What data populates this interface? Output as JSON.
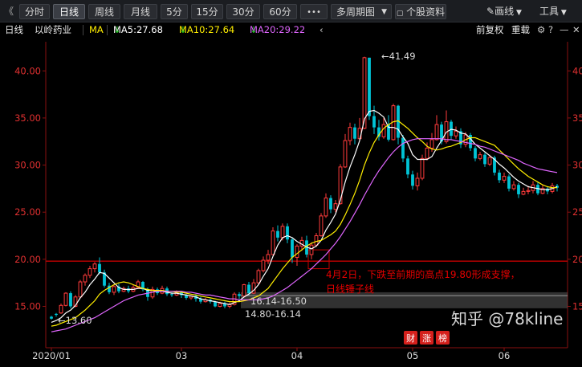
{
  "toolbar": {
    "back_icon": "chevron-left-icon",
    "tabs": [
      "分时",
      "日线",
      "周线",
      "月线",
      "5分",
      "15分",
      "30分",
      "60分"
    ],
    "active_tab": "日线",
    "more": "•••",
    "multi_period": "多周期图",
    "stock_info": "个股资料",
    "draw_line": "画线",
    "tools": "工具",
    "dropdown_icon": "triangle-down-icon",
    "pen_icon": "pen-icon",
    "window_icons": [
      "maximize-icon",
      "close-icon"
    ]
  },
  "infobar": {
    "period": "日线",
    "name": "以岭药业",
    "ma": "MA",
    "ma5": "MA5:27.68",
    "ma10": "MA10:27.64",
    "ma20": "MA20:29.22",
    "collapse_icon": "chevron-left-icon",
    "adjust": "前复权",
    "overlay": "重载",
    "icons": [
      "settings-icon",
      "help-icon",
      "minimize-icon",
      "close-icon"
    ]
  },
  "colors": {
    "up": "#ff3b3b",
    "down": "#00c4d6",
    "ma5": "#ffffff",
    "ma10": "#ffee00",
    "ma20": "#e066ff",
    "support_line": "#c40000",
    "axis_text": "#e03030",
    "annotation": "#e60000"
  },
  "annotations": {
    "high_label": "41.49",
    "low_label": "13.60",
    "box_label1": "16.14-16.50",
    "box_label2": "14.80-16.14",
    "note_line1": "4月2日，下跌至前期的高点19.80形成支撑，",
    "note_line2": "日线锤子线"
  },
  "watermark": {
    "badge1": "财",
    "badge2": "涨",
    "badge3": "榜",
    "text": "知乎 @78kline"
  },
  "chart_data": {
    "type": "candlestick",
    "title": "以岭药业 日线",
    "xlabel": "",
    "ylabel": "",
    "ylim": [
      12,
      43
    ],
    "y_ticks": [
      15,
      20,
      25,
      30,
      35,
      40
    ],
    "y_tick_labels_left": [
      "15.00",
      "20.00",
      "25.00",
      "30.00",
      "35.00",
      "40.00"
    ],
    "y_tick_labels_right": [
      "15",
      "20",
      "25",
      "30",
      "35",
      "40"
    ],
    "x_tick_labels": [
      {
        "label": "2020/01",
        "index": 0
      },
      {
        "label": "03",
        "index": 27
      },
      {
        "label": "04",
        "index": 51
      },
      {
        "label": "05",
        "index": 75
      },
      {
        "label": "06",
        "index": 94
      }
    ],
    "support_level": 19.8,
    "support_box": [
      14.8,
      16.5
    ],
    "grid": false,
    "candles": [
      [
        13.9,
        13.7,
        14.0,
        13.6
      ],
      [
        14.2,
        14.1,
        14.3,
        13.9
      ],
      [
        14.3,
        15.1,
        15.3,
        14.2
      ],
      [
        15.1,
        16.4,
        16.5,
        15.0
      ],
      [
        16.4,
        15.0,
        16.6,
        14.8
      ],
      [
        15.0,
        16.0,
        16.2,
        14.9
      ],
      [
        16.0,
        17.6,
        17.8,
        15.9
      ],
      [
        17.6,
        18.3,
        18.5,
        17.2
      ],
      [
        18.3,
        19.0,
        19.3,
        18.0
      ],
      [
        19.0,
        19.5,
        19.7,
        18.6
      ],
      [
        19.5,
        18.6,
        20.2,
        18.4
      ],
      [
        18.6,
        17.2,
        18.9,
        17.0
      ],
      [
        17.2,
        16.5,
        17.5,
        16.3
      ],
      [
        16.5,
        17.1,
        17.3,
        16.2
      ],
      [
        17.1,
        16.6,
        17.4,
        16.4
      ],
      [
        16.6,
        16.9,
        17.1,
        16.5
      ],
      [
        16.9,
        16.6,
        17.2,
        16.4
      ],
      [
        16.6,
        17.0,
        17.3,
        16.5
      ],
      [
        17.0,
        17.6,
        17.8,
        16.9
      ],
      [
        17.6,
        16.8,
        17.7,
        16.6
      ],
      [
        16.8,
        16.0,
        17.0,
        15.6
      ],
      [
        16.0,
        16.8,
        17.1,
        15.8
      ],
      [
        16.8,
        16.4,
        17.0,
        16.2
      ],
      [
        16.4,
        16.9,
        17.2,
        16.3
      ],
      [
        16.9,
        16.3,
        17.1,
        16.1
      ],
      [
        16.3,
        16.2,
        16.5,
        16.0
      ],
      [
        16.2,
        16.5,
        16.7,
        16.1
      ],
      [
        16.5,
        16.2,
        16.6,
        15.9
      ],
      [
        16.2,
        15.9,
        16.3,
        15.7
      ],
      [
        15.9,
        16.1,
        16.2,
        15.7
      ],
      [
        16.1,
        15.8,
        16.3,
        15.5
      ],
      [
        15.8,
        15.5,
        16.0,
        15.3
      ],
      [
        15.5,
        15.7,
        15.9,
        15.4
      ],
      [
        15.7,
        15.5,
        15.8,
        15.3
      ],
      [
        15.5,
        15.0,
        15.6,
        14.9
      ],
      [
        15.0,
        15.3,
        15.5,
        14.9
      ],
      [
        15.3,
        15.0,
        15.5,
        14.8
      ],
      [
        15.0,
        15.2,
        15.4,
        14.8
      ],
      [
        15.2,
        16.3,
        16.5,
        15.1
      ],
      [
        16.3,
        16.1,
        16.5,
        15.8
      ],
      [
        16.1,
        17.3,
        17.4,
        16.0
      ],
      [
        17.3,
        16.4,
        17.6,
        16.2
      ],
      [
        16.4,
        17.5,
        17.9,
        16.3
      ],
      [
        17.5,
        18.8,
        19.0,
        17.3
      ],
      [
        18.8,
        19.9,
        20.3,
        18.6
      ],
      [
        19.9,
        20.5,
        21.0,
        19.5
      ],
      [
        20.5,
        23.0,
        23.4,
        20.4
      ],
      [
        23.0,
        22.3,
        23.6,
        21.9
      ],
      [
        22.3,
        23.5,
        23.8,
        22.0
      ],
      [
        23.5,
        22.1,
        23.8,
        21.7
      ],
      [
        22.1,
        20.2,
        22.3,
        19.6
      ],
      [
        20.2,
        21.4,
        21.6,
        19.3
      ],
      [
        21.4,
        22.0,
        22.4,
        20.9
      ],
      [
        22.0,
        20.5,
        22.5,
        20.2
      ],
      [
        20.5,
        21.5,
        21.8,
        20.0
      ],
      [
        21.5,
        22.5,
        22.8,
        21.3
      ],
      [
        22.5,
        24.6,
        24.9,
        22.4
      ],
      [
        24.6,
        26.5,
        27.0,
        24.4
      ],
      [
        26.5,
        25.3,
        26.8,
        24.9
      ],
      [
        25.3,
        25.9,
        26.3,
        25.0
      ],
      [
        25.9,
        29.8,
        30.1,
        25.8
      ],
      [
        29.8,
        32.6,
        33.3,
        29.7
      ],
      [
        32.6,
        34.0,
        34.5,
        32.1
      ],
      [
        34.0,
        32.8,
        34.4,
        32.2
      ],
      [
        32.8,
        33.9,
        35.0,
        32.6
      ],
      [
        33.9,
        41.4,
        41.5,
        33.8
      ],
      [
        41.4,
        35.2,
        41.4,
        34.8
      ],
      [
        35.2,
        34.0,
        36.3,
        33.3
      ],
      [
        34.0,
        33.0,
        34.8,
        32.6
      ],
      [
        33.0,
        34.3,
        35.0,
        32.8
      ],
      [
        34.3,
        32.7,
        35.3,
        32.5
      ],
      [
        32.7,
        36.3,
        36.5,
        32.6
      ],
      [
        36.3,
        32.9,
        36.4,
        32.2
      ],
      [
        32.9,
        30.7,
        33.2,
        30.3
      ],
      [
        30.7,
        29.0,
        31.0,
        28.6
      ],
      [
        29.0,
        27.8,
        29.4,
        27.4
      ],
      [
        27.8,
        28.6,
        29.2,
        27.3
      ],
      [
        28.6,
        30.7,
        31.1,
        28.4
      ],
      [
        30.7,
        31.8,
        32.4,
        30.5
      ],
      [
        31.8,
        32.7,
        33.4,
        31.4
      ],
      [
        32.7,
        34.3,
        35.3,
        32.6
      ],
      [
        34.3,
        32.5,
        34.6,
        32.2
      ],
      [
        32.5,
        34.6,
        35.8,
        32.3
      ],
      [
        34.6,
        33.1,
        34.8,
        32.7
      ],
      [
        33.1,
        33.6,
        34.1,
        32.8
      ],
      [
        33.6,
        32.2,
        33.9,
        31.8
      ],
      [
        32.2,
        33.2,
        33.5,
        31.9
      ],
      [
        33.2,
        31.8,
        33.4,
        31.5
      ],
      [
        31.8,
        30.7,
        32.0,
        30.4
      ],
      [
        30.7,
        31.1,
        31.4,
        30.5
      ],
      [
        31.1,
        30.1,
        31.3,
        29.8
      ],
      [
        30.1,
        30.8,
        31.1,
        29.9
      ],
      [
        30.8,
        29.2,
        31.0,
        28.9
      ],
      [
        29.2,
        28.4,
        29.5,
        28.1
      ],
      [
        28.4,
        28.8,
        29.2,
        28.1
      ],
      [
        28.8,
        27.5,
        29.0,
        27.2
      ],
      [
        27.5,
        27.9,
        28.3,
        27.3
      ],
      [
        27.9,
        26.9,
        28.1,
        26.5
      ],
      [
        26.9,
        27.2,
        27.6,
        26.8
      ],
      [
        27.2,
        27.3,
        27.8,
        26.9
      ],
      [
        27.3,
        27.9,
        28.3,
        27.0
      ],
      [
        27.9,
        27.0,
        28.2,
        26.8
      ],
      [
        27.0,
        27.5,
        27.9,
        26.9
      ],
      [
        27.5,
        27.2,
        27.7,
        26.9
      ],
      [
        27.2,
        27.8,
        28.1,
        27.0
      ],
      [
        27.8,
        27.6,
        28.0,
        27.2
      ]
    ],
    "series": [
      {
        "name": "MA5",
        "values": [
          13.3,
          13.5,
          13.8,
          14.3,
          14.6,
          15.1,
          15.9,
          16.5,
          17.3,
          17.9,
          18.6,
          18.5,
          18.0,
          17.5,
          17.0,
          16.8,
          16.8,
          16.8,
          16.9,
          16.9,
          16.7,
          16.7,
          16.6,
          16.6,
          16.5,
          16.4,
          16.4,
          16.3,
          16.2,
          16.1,
          16.0,
          15.8,
          15.7,
          15.6,
          15.5,
          15.4,
          15.3,
          15.2,
          15.4,
          15.6,
          16.0,
          16.3,
          16.7,
          17.3,
          18.2,
          19.0,
          20.3,
          21.5,
          22.3,
          22.5,
          22.3,
          21.9,
          21.6,
          21.3,
          21.1,
          21.4,
          22.0,
          23.1,
          23.9,
          24.8,
          26.3,
          28.2,
          29.8,
          31.1,
          32.6,
          34.9,
          35.7,
          35.8,
          35.5,
          35.1,
          34.0,
          34.0,
          33.8,
          33.0,
          32.3,
          31.1,
          30.6,
          30.6,
          30.6,
          30.9,
          31.8,
          32.6,
          33.5,
          33.8,
          33.7,
          33.4,
          33.3,
          32.8,
          32.2,
          31.8,
          31.4,
          31.0,
          30.6,
          30.1,
          29.7,
          29.2,
          28.7,
          28.3,
          28.0,
          27.7,
          27.6,
          27.5,
          27.4,
          27.4,
          27.5,
          27.7
        ]
      },
      {
        "name": "MA10",
        "values": [
          12.9,
          13.0,
          13.2,
          13.4,
          13.6,
          13.8,
          14.2,
          14.6,
          15.1,
          15.6,
          16.3,
          16.7,
          17.0,
          17.3,
          17.5,
          17.6,
          17.5,
          17.3,
          17.1,
          16.9,
          16.8,
          16.7,
          16.7,
          16.7,
          16.6,
          16.6,
          16.5,
          16.5,
          16.4,
          16.3,
          16.2,
          16.1,
          16.0,
          15.9,
          15.8,
          15.7,
          15.6,
          15.5,
          15.5,
          15.5,
          15.6,
          15.7,
          15.9,
          16.1,
          16.5,
          16.9,
          17.6,
          18.3,
          19.0,
          19.6,
          20.2,
          20.6,
          21.0,
          21.4,
          21.7,
          21.9,
          22.0,
          22.3,
          22.6,
          23.0,
          23.7,
          24.7,
          25.8,
          27.0,
          28.4,
          30.0,
          31.3,
          32.4,
          33.2,
          33.9,
          34.3,
          34.6,
          34.7,
          34.3,
          33.9,
          33.4,
          32.9,
          32.5,
          32.0,
          31.7,
          31.6,
          31.7,
          31.9,
          32.0,
          32.2,
          32.4,
          32.7,
          32.9,
          32.9,
          32.7,
          32.5,
          32.3,
          32.1,
          31.6,
          31.1,
          30.6,
          30.1,
          29.6,
          29.2,
          28.8,
          28.5,
          28.2,
          27.9,
          27.7,
          27.6,
          27.6
        ]
      },
      {
        "name": "MA20",
        "values": [
          12.3,
          12.4,
          12.5,
          12.6,
          12.8,
          13.0,
          13.2,
          13.4,
          13.6,
          13.8,
          14.1,
          14.4,
          14.7,
          15.0,
          15.3,
          15.6,
          15.8,
          16.0,
          16.2,
          16.3,
          16.4,
          16.5,
          16.6,
          16.6,
          16.6,
          16.6,
          16.6,
          16.6,
          16.5,
          16.5,
          16.4,
          16.3,
          16.2,
          16.2,
          16.1,
          16.0,
          15.9,
          15.8,
          15.8,
          15.7,
          15.7,
          15.7,
          15.7,
          15.7,
          15.8,
          15.9,
          16.1,
          16.4,
          16.7,
          17.0,
          17.4,
          17.8,
          18.2,
          18.6,
          19.0,
          19.5,
          20.0,
          20.5,
          21.1,
          21.7,
          22.4,
          23.2,
          24.0,
          24.9,
          25.8,
          26.8,
          27.7,
          28.6,
          29.4,
          30.1,
          30.8,
          31.4,
          31.9,
          32.3,
          32.5,
          32.7,
          32.8,
          32.8,
          32.8,
          32.8,
          32.8,
          32.8,
          32.7,
          32.7,
          32.6,
          32.5,
          32.4,
          32.3,
          32.2,
          32.0,
          31.9,
          31.7,
          31.5,
          31.3,
          31.1,
          30.9,
          30.7,
          30.5,
          30.2,
          30.0,
          29.8,
          29.6,
          29.5,
          29.4,
          29.3,
          29.2
        ]
      }
    ]
  }
}
